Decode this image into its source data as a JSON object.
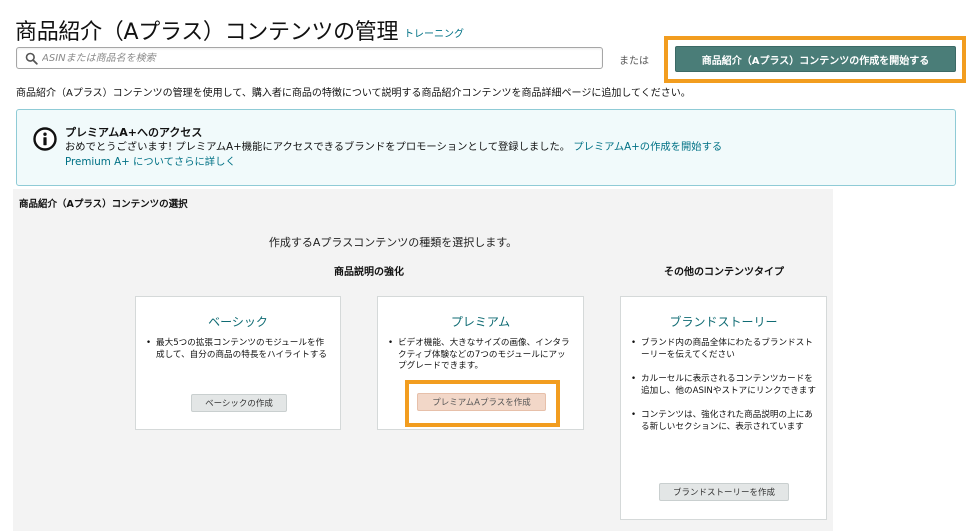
{
  "header": {
    "title": "商品紹介（Aプラス）コンテンツの管理",
    "training_link": "トレーニング"
  },
  "search": {
    "placeholder": "ASINまたは商品名を検索",
    "value": "",
    "or_label": "または",
    "start_button": "商品紹介（Aプラス）コンテンツの作成を開始する"
  },
  "description": "商品紹介（Aプラス）コンテンツの管理を使用して、購入者に商品の特徴について説明する商品紹介コンテンツを商品詳細ページに追加してください。",
  "alert": {
    "title": "プレミアムA+へのアクセス",
    "body": "おめでとうございます! プレミアムA+機能にアクセスできるブランドをプロモーションとして登録しました。",
    "link1": "プレミアムA+の作成を開始する",
    "link2": "Premium A+ についてさらに詳しく"
  },
  "selection": {
    "heading": "商品紹介（Aプラス）コンテンツの選択",
    "prompt": "作成するAプラスコンテンツの種類を選択します。",
    "group_enhance": "商品説明の強化",
    "group_other": "その他のコンテンツタイプ",
    "cards": [
      {
        "title": "ベーシック",
        "bullets": [
          "最大5つの拡張コンテンツのモジュールを作成して、自分の商品の特長をハイライトする"
        ],
        "button": "ベーシックの作成"
      },
      {
        "title": "プレミアム",
        "bullets": [
          "ビデオ機能、大きなサイズの画像、インタラクティブ体験などの7つのモジュールにアップグレードできます。"
        ],
        "button": "プレミアムAプラスを作成"
      },
      {
        "title": "ブランドストーリー",
        "bullets": [
          "ブランド内の商品全体にわたるブランドストーリーを伝えてください",
          "カルーセルに表示されるコンテンツカードを追加し、他のASINやストアにリンクできます",
          "コンテンツは、強化された商品説明の上にある新しいセクションに、表示されています"
        ],
        "button": "ブランドストーリーを作成"
      }
    ]
  },
  "colors": {
    "accent_teal": "#4a7d78",
    "link": "#007185",
    "highlight": "#f29d1f"
  },
  "icons": {
    "search": "search-icon",
    "info": "info-icon"
  }
}
